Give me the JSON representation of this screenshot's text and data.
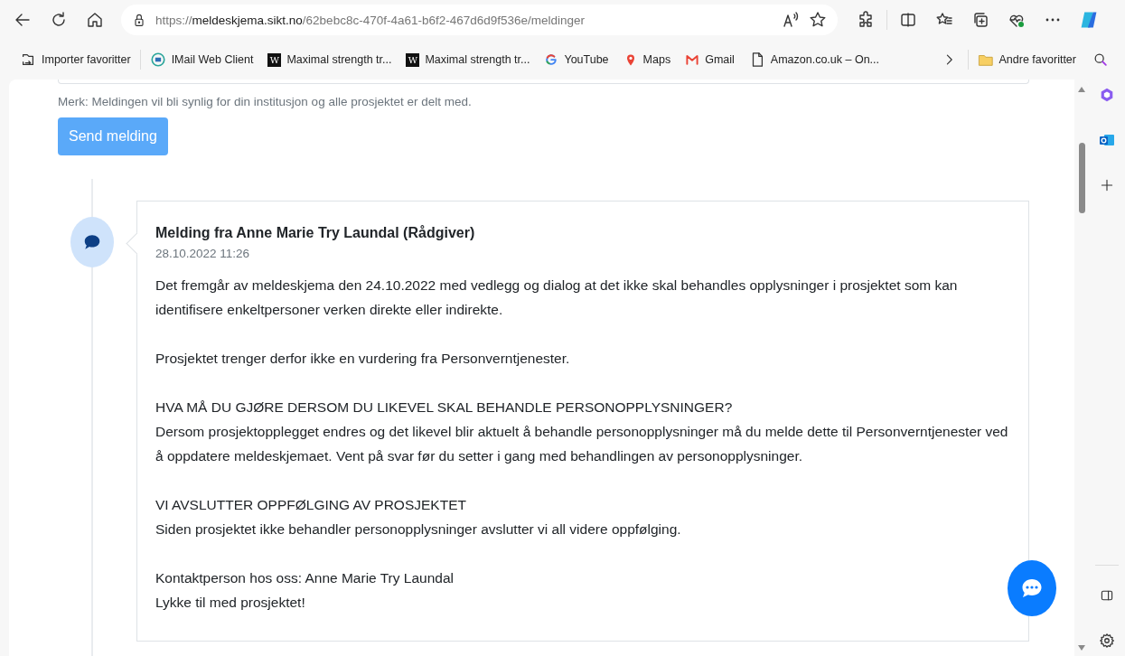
{
  "browser": {
    "url": "https://**meldeskjema.sikt.no**/62bebc8c-470f-4a61-b6f2-467d6d9f536e/meldinger",
    "bookmarks": [
      {
        "kind": "import",
        "label": "Importer favoritter"
      },
      {
        "kind": "mail",
        "label": "IMail Web Client"
      },
      {
        "kind": "letter",
        "badge": "W",
        "label": "Maximal strength tr..."
      },
      {
        "kind": "letter",
        "badge": "W",
        "label": "Maximal strength tr..."
      },
      {
        "kind": "google",
        "label": "YouTube"
      },
      {
        "kind": "pin",
        "label": "Maps"
      },
      {
        "kind": "gmail",
        "label": "Gmail"
      },
      {
        "kind": "doc",
        "label": "Amazon.co.uk – On..."
      }
    ],
    "other_favorites": "Andre favoritter"
  },
  "page": {
    "note": "Merk: Meldingen vil bli synlig for din institusjon og alle prosjektet er delt med.",
    "send_button": "Send melding",
    "messages": [
      {
        "title": "Melding fra Anne Marie Try Laundal (Rådgiver)",
        "date": "28.10.2022 11:26",
        "paragraphs": [
          [
            "Det fremgår av meldeskjema den 24.10.2022 med vedlegg og dialog at det ikke skal behandles opplysninger i prosjektet som kan identifisere enkeltpersoner verken direkte eller indirekte."
          ],
          [
            "Prosjektet trenger derfor ikke en vurdering fra Personverntjenester."
          ],
          [
            "HVA MÅ DU GJØRE DERSOM DU LIKEVEL SKAL BEHANDLE PERSONOPPLYSNINGER?",
            "Dersom prosjektopplegget endres og det likevel blir aktuelt å behandle personopplysninger må du melde dette til Personverntjenester ved å oppdatere meldeskjemaet. Vent på svar før du setter i gang med behandlingen av personopplysninger."
          ],
          [
            "VI AVSLUTTER OPPFØLGING AV PROSJEKTET",
            "Siden prosjektet ikke behandler personopplysninger avslutter vi all videre oppfølging."
          ],
          [
            "Kontaktperson hos oss: Anne Marie Try Laundal",
            "Lykke til med prosjektet!"
          ]
        ]
      }
    ]
  }
}
